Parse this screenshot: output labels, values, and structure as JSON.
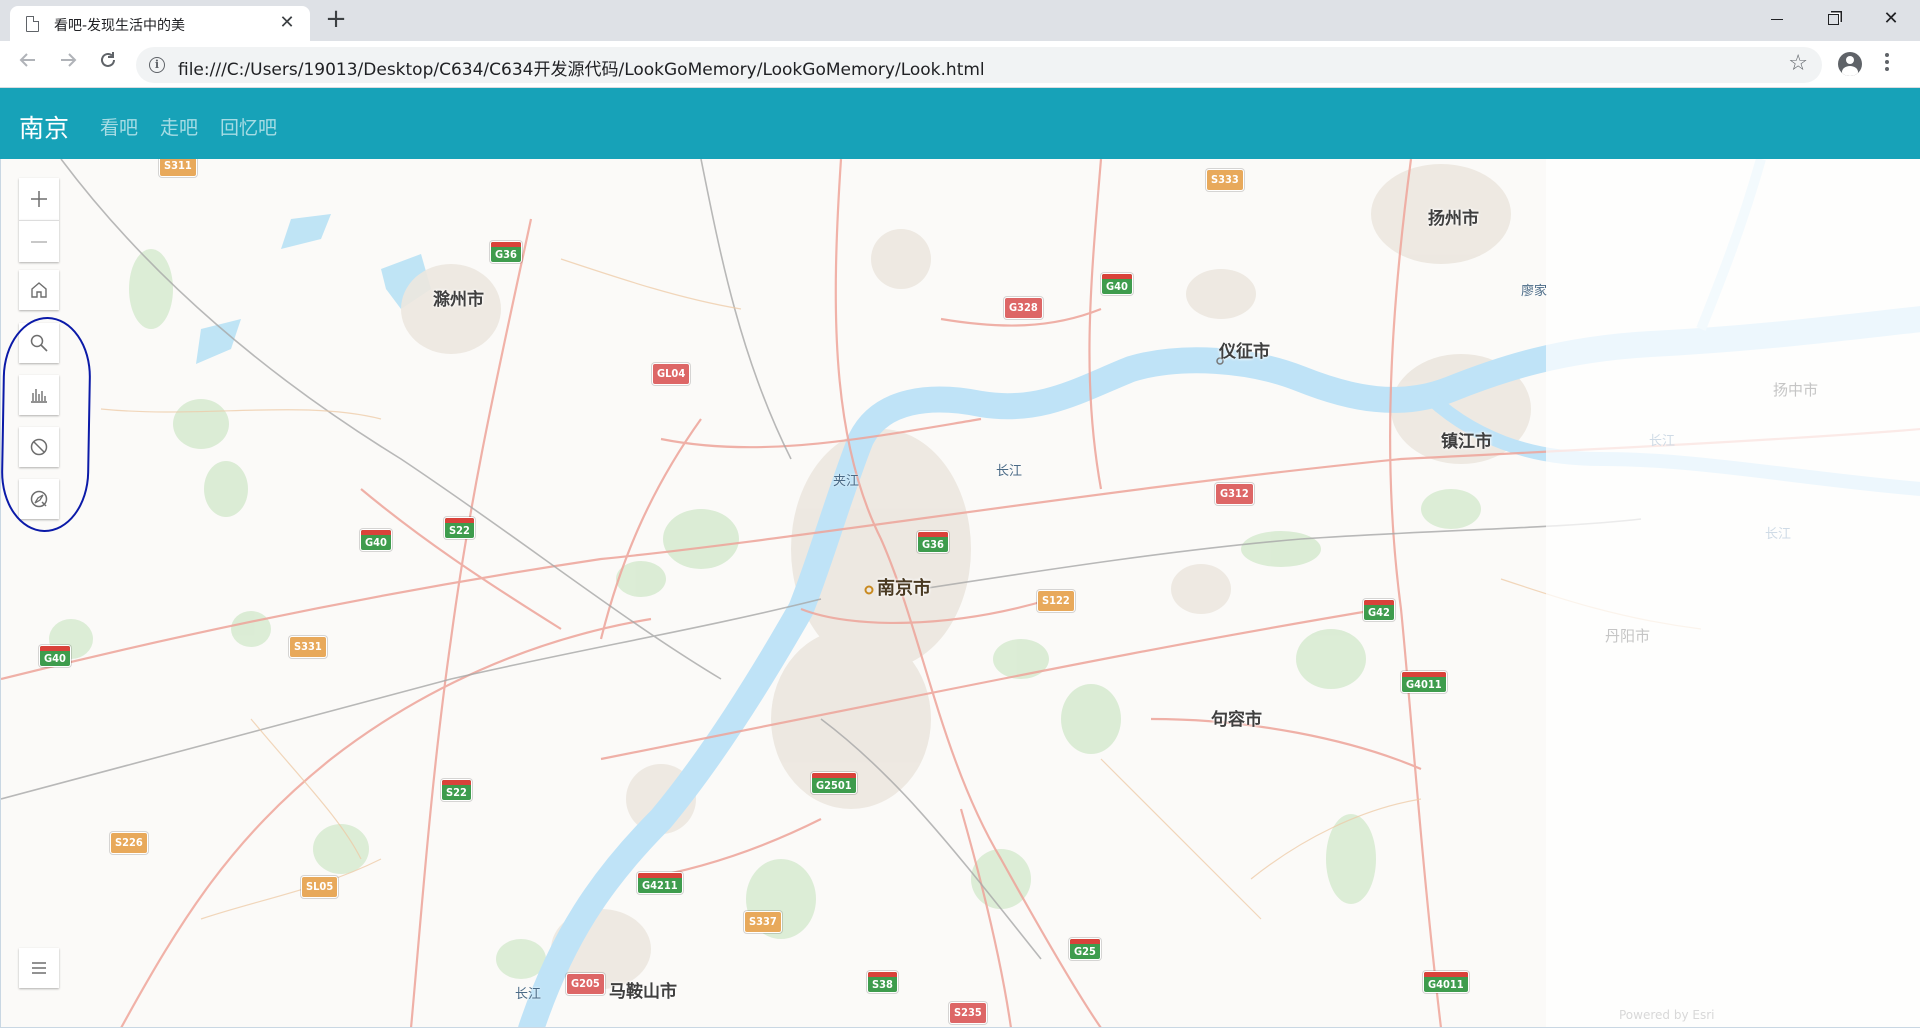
{
  "browser": {
    "tab_title": "看吧-发现生活中的美",
    "tab_close": "✕",
    "new_tab": "+",
    "url": "file:///C:/Users/19013/Desktop/C634/C634开发源代码/LookGoMemory/LookGoMemory/Look.html",
    "info": "i",
    "star": "☆",
    "close": "✕"
  },
  "header": {
    "brand": "南京",
    "nav": [
      "看吧",
      "走吧",
      "回忆吧"
    ],
    "color": "#17a2b8"
  },
  "map": {
    "cities": {
      "nanjing": "南京市",
      "chuzhou": "滁州市",
      "yangzhou": "扬州市",
      "yizheng": "仪征市",
      "zhenjiang": "镇江市",
      "jurong": "句容市",
      "maanshan": "马鞍山市",
      "yangzhong": "扬中市",
      "danyang": "丹阳市",
      "liaojia": "廖家"
    },
    "rivers": {
      "jiajiang": "夹江",
      "changjiang_1": "长江",
      "changjiang_2": "长江",
      "changjiang_faded_1": "长江",
      "changjiang_faded_2": "长江"
    },
    "shields": {
      "s311": "S311",
      "g36_top": "G36",
      "s333": "S333",
      "g40_top": "G40",
      "g328": "G328",
      "gl04": "GL04",
      "g312": "G312",
      "g40_left": "G40",
      "s22_a": "S22",
      "g36_mid": "G36",
      "s122": "S122",
      "g42": "G42",
      "g40_far": "G40",
      "s331": "S331",
      "g4011_r": "G4011",
      "s22_b": "S22",
      "g2501": "G2501",
      "s226": "S226",
      "sl05": "SL05",
      "g4211": "G4211",
      "s337": "S337",
      "g25": "G25",
      "g205": "G205",
      "s38": "S38",
      "g4011_b": "G4011",
      "s235": "S235"
    },
    "powered_by": "Powered by Esri"
  },
  "widgets": {
    "zoom_in": "+",
    "zoom_out": "—",
    "highlight_color": "#0b1aa8"
  }
}
